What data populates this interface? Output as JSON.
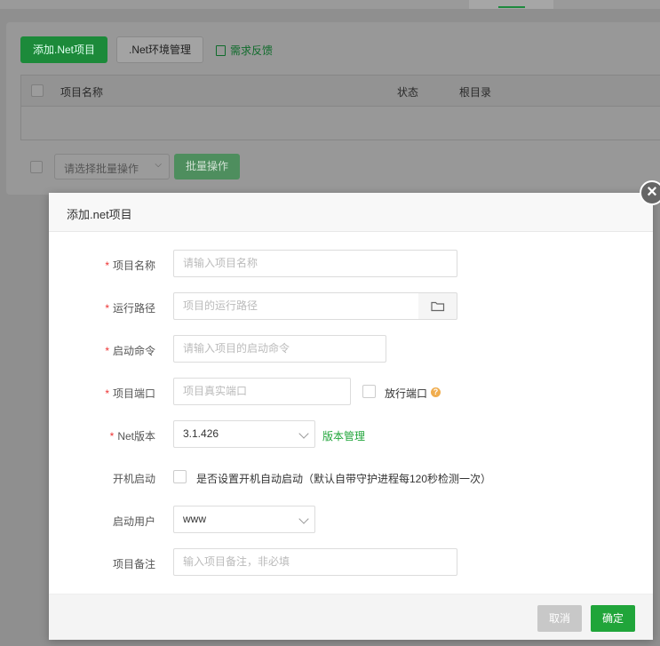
{
  "background": {
    "toolbar": {
      "add_project_label": "添加.Net项目",
      "env_manage_label": ".Net环境管理",
      "feedback_label": "需求反馈"
    },
    "table": {
      "columns": [
        "项目名称",
        "状态",
        "根目录"
      ]
    },
    "batch": {
      "select_placeholder": "请选择批量操作",
      "button_label": "批量操作"
    }
  },
  "modal": {
    "title": "添加.net项目",
    "close_glyph": "×",
    "required_mark": "*",
    "fields": {
      "project_name": {
        "label": "项目名称",
        "placeholder": "请输入项目名称"
      },
      "run_path": {
        "label": "运行路径",
        "placeholder": "项目的运行路径"
      },
      "start_command": {
        "label": "启动命令",
        "placeholder": "请输入项目的启动命令"
      },
      "project_port": {
        "label": "项目端口",
        "placeholder": "项目真实端口",
        "open_port_label": "放行端口",
        "help_glyph": "?"
      },
      "net_version": {
        "label": "Net版本",
        "value": "3.1.426",
        "manage_link": "版本管理"
      },
      "autostart": {
        "label": "开机启动",
        "description": "是否设置开机自动启动（默认自带守护进程每120秒检测一次）"
      },
      "start_user": {
        "label": "启动用户",
        "value": "www"
      },
      "remark": {
        "label": "项目备注",
        "placeholder": "输入项目备注，非必填"
      }
    },
    "footer": {
      "cancel_label": "取消",
      "confirm_label": "确定"
    }
  },
  "colors": {
    "accent": "#20a53a",
    "required": "#ee3333",
    "help": "#f0ad4e"
  }
}
